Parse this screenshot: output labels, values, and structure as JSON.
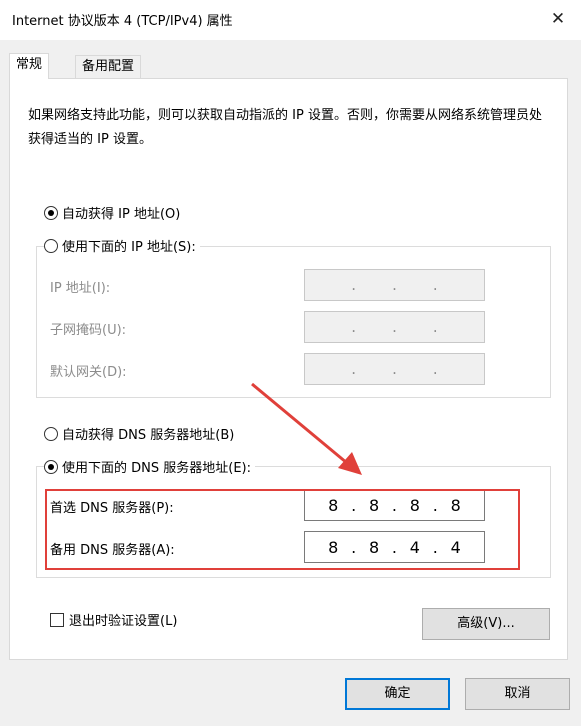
{
  "window": {
    "title": "Internet 协议版本 4 (TCP/IPv4) 属性",
    "close_glyph": "✕"
  },
  "tabs": [
    {
      "label": "常规"
    },
    {
      "label": "备用配置"
    }
  ],
  "description": "如果网络支持此功能，则可以获取自动指派的 IP 设置。否则，你需要从网络系统管理员处获得适当的 IP 设置。",
  "ip_section": {
    "auto_label": "自动获得 IP 地址(O)",
    "manual_label": "使用下面的 IP 地址(S):",
    "auto_selected": true,
    "fields": [
      {
        "label": "IP 地址(I):",
        "value": [
          "",
          "",
          "",
          ""
        ]
      },
      {
        "label": "子网掩码(U):",
        "value": [
          "",
          "",
          "",
          ""
        ]
      },
      {
        "label": "默认网关(D):",
        "value": [
          "",
          "",
          "",
          ""
        ]
      }
    ]
  },
  "dns_section": {
    "auto_label": "自动获得 DNS 服务器地址(B)",
    "manual_label": "使用下面的 DNS 服务器地址(E):",
    "manual_selected": true,
    "fields": [
      {
        "label": "首选 DNS 服务器(P):",
        "value": [
          "8",
          "8",
          "8",
          "8"
        ]
      },
      {
        "label": "备用 DNS 服务器(A):",
        "value": [
          "8",
          "8",
          "4",
          "4"
        ]
      }
    ]
  },
  "validate_label": "退出时验证设置(L)",
  "validate_checked": false,
  "buttons": {
    "advanced": "高级(V)...",
    "ok": "确定",
    "cancel": "取消"
  },
  "colors": {
    "annotation": "#e0403a",
    "focus": "#0078d7"
  }
}
